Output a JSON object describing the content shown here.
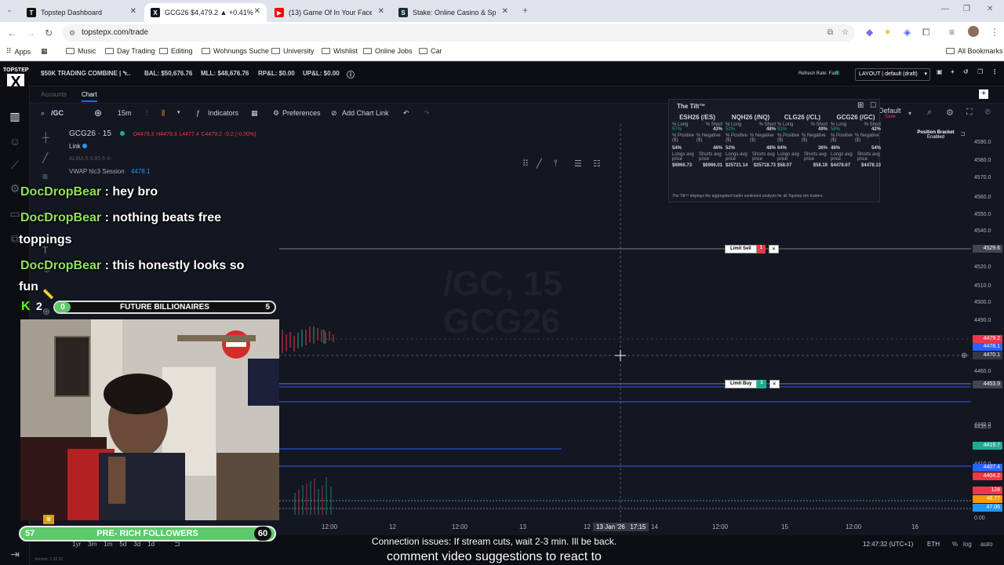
{
  "browser": {
    "tabs": [
      {
        "title": "Topstep Dashboard",
        "icon": "topstep-icon"
      },
      {
        "title": "GCG26 $4,479.2 ▲ +0.41%",
        "icon": "tradingview-icon"
      },
      {
        "title": "(13) Game Of In Your Face!",
        "icon": "youtube-icon"
      },
      {
        "title": "Stake: Online Casino & Sportsb",
        "icon": "stake-icon"
      }
    ],
    "url": "topstepx.com/trade",
    "bookmarks": [
      "Apps",
      "Music",
      "Day Trading",
      "Editing",
      "Wohnungs Suche",
      "University",
      "Wishlist",
      "Online Jobs",
      "Car"
    ],
    "all_bookmarks": "All Bookmarks"
  },
  "app_header": {
    "logo_text": "TOPSTEP",
    "logo_letter": "X",
    "account": "$50K TRADING COMBINE | *...",
    "bal": "BAL: $50,676.76",
    "mll": "MLL: $48,676.76",
    "rpl": "RP&L: $0.00",
    "upl": "UP&L: $0.00",
    "refresh_rate": "Refresh Rate: Fast",
    "layout": "LAYOUT | default (draft)"
  },
  "chart_tabs": {
    "accounts": "Accounts",
    "chart": "Chart"
  },
  "toolbar": {
    "symbol": "/GC",
    "interval": "15m",
    "indicators": "Indicators",
    "preferences": "Preferences",
    "add_chart_link": "Add Chart Link",
    "default_label": "Default",
    "save_label": "Save"
  },
  "legend": {
    "symbol": "GCG26 · 15",
    "ohlc": {
      "o": "O4479.3",
      "h": "H4479.3",
      "l": "L4477.4",
      "c": "C4479.2",
      "chg": "-0.2 (-0.00%)"
    },
    "link": "Link",
    "alma": "ALMA 9 0.85 6",
    "vwap": "VWAP hlc3 Session",
    "vwap_value": "4478.1"
  },
  "watermark": {
    "line1": "/GC, 15",
    "line2": "GCG26"
  },
  "position_bracket": {
    "title": "Position Bracket",
    "status": "Enabled"
  },
  "tilt": {
    "title": "The Tilt™",
    "columns": [
      {
        "name": "ESH26 (/ES)",
        "long": "57%",
        "short": "43%",
        "pos": "54%",
        "neg": "46%",
        "long_avg": "$6966.73",
        "short_avg": "$6966.01"
      },
      {
        "name": "NQH26 (/NQ)",
        "long": "52%",
        "short": "48%",
        "pos": "52%",
        "neg": "48%",
        "long_avg": "$25721.14",
        "short_avg": "$25718.73"
      },
      {
        "name": "CLG26 (/CL)",
        "long": "51%",
        "short": "49%",
        "pos": "64%",
        "neg": "36%",
        "long_avg": "$58.07",
        "short_avg": "$58.19"
      },
      {
        "name": "GCG26 (/GC)",
        "long": "58%",
        "short": "42%",
        "pos": "46%",
        "neg": "54%",
        "long_avg": "$4478.67",
        "short_avg": "$4478.13"
      }
    ],
    "labels": {
      "long": "% Long",
      "short": "% Short",
      "pos": "% Positive ($)",
      "neg": "% Negative ($)",
      "long_avg": "Longs avg price",
      "short_avg": "Shorts avg price"
    },
    "footer": "The Tilt™ displays the aggregated trader sentiment analysis for all Topstep sim traders."
  },
  "orders": {
    "limit_sell": {
      "label": "Limit Sell",
      "qty": "1",
      "price": "4529.6"
    },
    "limit_buy": {
      "label": "Limit Buy",
      "qty": "1",
      "price": "4453.9"
    }
  },
  "price_axis": {
    "ticks": [
      "4590.0",
      "4580.0",
      "4570.0",
      "4560.0",
      "4550.0",
      "4540.0",
      "4520.0",
      "4510.0",
      "4500.0",
      "4490.0",
      "4460.0",
      "4440.0",
      "4430.0",
      "4410.0",
      "0.00"
    ],
    "labels": [
      {
        "text": "4529.6",
        "color": "#434651"
      },
      {
        "text": "4479.2",
        "color": "#f23645"
      },
      {
        "text": "4478.1",
        "color": "#2962ff"
      },
      {
        "text": "4470.1",
        "color": "#363a45"
      },
      {
        "text": "4453.9",
        "color": "#434651"
      },
      {
        "text": "4419.7",
        "color": "#22ab94"
      },
      {
        "text": "4407.4",
        "color": "#2962ff"
      },
      {
        "text": "4404.2",
        "color": "#f23645"
      },
      {
        "text": "128",
        "color": "#f23645"
      },
      {
        "text": "48.77",
        "color": "#ff9800"
      },
      {
        "text": "47.06",
        "color": "#2196f3"
      }
    ]
  },
  "time_axis": {
    "labels": [
      "12:00",
      "12",
      "12:00",
      "13",
      "12",
      "14",
      "12:00",
      "15",
      "12:00",
      "16"
    ],
    "crosshair_date": "13 Jan '26",
    "crosshair_time": "17:15"
  },
  "bottom": {
    "ranges": [
      "1yr",
      "3m",
      "1m",
      "5d",
      "3d",
      "1d"
    ],
    "clock": "12:47:32 (UTC+1)",
    "session": "ETH",
    "pct": "%",
    "log": "log",
    "auto": "auto",
    "version": "Version: 1.22.32"
  },
  "stream": {
    "chat": [
      {
        "user": "DocDropBear",
        "msg": ": hey bro"
      },
      {
        "user": "DocDropBear",
        "msg": ": nothing beats free"
      },
      {
        "user": "",
        "msg": "toppings"
      },
      {
        "user": "DocDropBear",
        "msg": ": this honestly looks so"
      },
      {
        "user": "",
        "msg": "fun"
      }
    ],
    "kick_count": "2",
    "goal1": {
      "current": "0",
      "label": "FUTURE BILLIONAIRES",
      "target": "5"
    },
    "goal2": {
      "current": "57",
      "label": "PRE- RICH FOLLOWERS",
      "target": "60"
    },
    "subtitle1": "Connection issues: If stream cuts, wait 2-3 min. Ill be back.",
    "subtitle2": "comment video suggestions to react to"
  },
  "colors": {
    "bg": "#131722",
    "accent_green": "#8fe25a",
    "sell": "#f23645",
    "buy": "#22ab94",
    "blue_line": "#2962ff"
  }
}
